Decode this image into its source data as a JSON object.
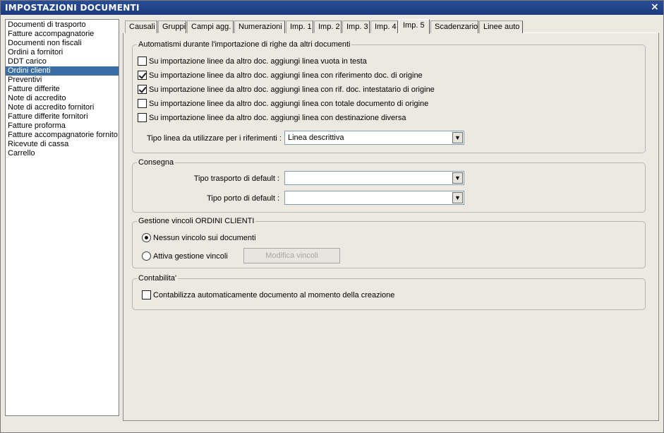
{
  "window": {
    "title": "IMPOSTAZIONI DOCUMENTI",
    "close_glyph": "×"
  },
  "doc_list": {
    "items": [
      "Documenti di trasporto",
      "Fatture accompagnatorie",
      "Documenti non fiscali",
      "Ordini a fornitori",
      "DDT carico",
      "Ordini clienti",
      "Preventivi",
      "Fatture differite",
      "Note di accredito",
      "Note di accredito fornitori",
      "Fatture differite fornitori",
      "Fatture proforma",
      "Fatture accompagnatorie fornito",
      "Ricevute di cassa",
      "Carrello"
    ],
    "selected": "Ordini clienti"
  },
  "tabs": [
    "Causali",
    "Gruppi",
    "Campi agg.",
    "Numerazioni",
    "Imp. 1",
    "Imp. 2",
    "Imp. 3",
    "Imp. 4",
    "Imp. 5",
    "Scadenzario",
    "Linee auto"
  ],
  "active_tab": "Imp. 5",
  "import_group": {
    "legend": "Automatismi durante l'importazione di righe da altri documenti",
    "options": [
      {
        "label": "Su importazione linee da altro doc. aggiungi linea vuota in testa",
        "checked": false
      },
      {
        "label": "Su importazione linee da altro doc. aggiungi linea con riferimento doc. di origine",
        "checked": true
      },
      {
        "label": "Su importazione linee da altro doc. aggiungi linea con rif. doc. intestatario di origine",
        "checked": true
      },
      {
        "label": "Su importazione linee da altro doc. aggiungi linea con totale documento di origine",
        "checked": false
      },
      {
        "label": "Su importazione linee da altro doc. aggiungi linea con destinazione diversa",
        "checked": false
      }
    ],
    "ref_type_label": "Tipo linea da utilizzare per i riferimenti :",
    "ref_type_value": "Linea descrittiva"
  },
  "consegna_group": {
    "legend": "Consegna",
    "transport_label": "Tipo trasporto di default :",
    "transport_value": "",
    "porto_label": "Tipo porto di default :",
    "porto_value": ""
  },
  "vincoli_group": {
    "legend": "Gestione vincoli ORDINI CLIENTI",
    "option_none": "Nessun vincolo sui documenti",
    "option_active": "Attiva gestione vincoli",
    "selected": "none",
    "modify_button": "Modifica vincoli"
  },
  "contabilita_group": {
    "legend": "Contabilita'",
    "auto_label": "Contabilizza automaticamente documento al momento della creazione",
    "auto_checked": false
  },
  "icons": {
    "dropdown": "▼"
  }
}
